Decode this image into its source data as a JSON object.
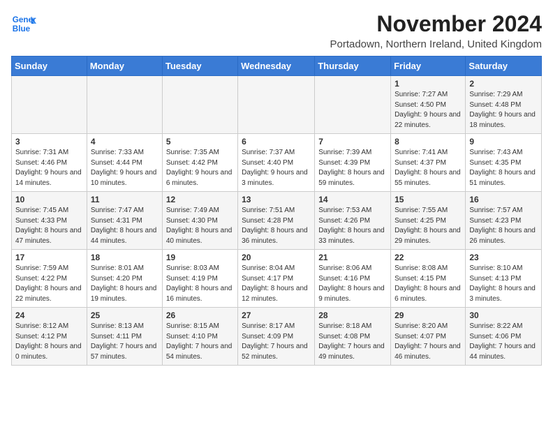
{
  "header": {
    "logo_line1": "General",
    "logo_line2": "Blue",
    "title": "November 2024",
    "subtitle": "Portadown, Northern Ireland, United Kingdom"
  },
  "days_of_week": [
    "Sunday",
    "Monday",
    "Tuesday",
    "Wednesday",
    "Thursday",
    "Friday",
    "Saturday"
  ],
  "weeks": [
    [
      {
        "day": "",
        "info": ""
      },
      {
        "day": "",
        "info": ""
      },
      {
        "day": "",
        "info": ""
      },
      {
        "day": "",
        "info": ""
      },
      {
        "day": "",
        "info": ""
      },
      {
        "day": "1",
        "info": "Sunrise: 7:27 AM\nSunset: 4:50 PM\nDaylight: 9 hours and 22 minutes."
      },
      {
        "day": "2",
        "info": "Sunrise: 7:29 AM\nSunset: 4:48 PM\nDaylight: 9 hours and 18 minutes."
      }
    ],
    [
      {
        "day": "3",
        "info": "Sunrise: 7:31 AM\nSunset: 4:46 PM\nDaylight: 9 hours and 14 minutes."
      },
      {
        "day": "4",
        "info": "Sunrise: 7:33 AM\nSunset: 4:44 PM\nDaylight: 9 hours and 10 minutes."
      },
      {
        "day": "5",
        "info": "Sunrise: 7:35 AM\nSunset: 4:42 PM\nDaylight: 9 hours and 6 minutes."
      },
      {
        "day": "6",
        "info": "Sunrise: 7:37 AM\nSunset: 4:40 PM\nDaylight: 9 hours and 3 minutes."
      },
      {
        "day": "7",
        "info": "Sunrise: 7:39 AM\nSunset: 4:39 PM\nDaylight: 8 hours and 59 minutes."
      },
      {
        "day": "8",
        "info": "Sunrise: 7:41 AM\nSunset: 4:37 PM\nDaylight: 8 hours and 55 minutes."
      },
      {
        "day": "9",
        "info": "Sunrise: 7:43 AM\nSunset: 4:35 PM\nDaylight: 8 hours and 51 minutes."
      }
    ],
    [
      {
        "day": "10",
        "info": "Sunrise: 7:45 AM\nSunset: 4:33 PM\nDaylight: 8 hours and 47 minutes."
      },
      {
        "day": "11",
        "info": "Sunrise: 7:47 AM\nSunset: 4:31 PM\nDaylight: 8 hours and 44 minutes."
      },
      {
        "day": "12",
        "info": "Sunrise: 7:49 AM\nSunset: 4:30 PM\nDaylight: 8 hours and 40 minutes."
      },
      {
        "day": "13",
        "info": "Sunrise: 7:51 AM\nSunset: 4:28 PM\nDaylight: 8 hours and 36 minutes."
      },
      {
        "day": "14",
        "info": "Sunrise: 7:53 AM\nSunset: 4:26 PM\nDaylight: 8 hours and 33 minutes."
      },
      {
        "day": "15",
        "info": "Sunrise: 7:55 AM\nSunset: 4:25 PM\nDaylight: 8 hours and 29 minutes."
      },
      {
        "day": "16",
        "info": "Sunrise: 7:57 AM\nSunset: 4:23 PM\nDaylight: 8 hours and 26 minutes."
      }
    ],
    [
      {
        "day": "17",
        "info": "Sunrise: 7:59 AM\nSunset: 4:22 PM\nDaylight: 8 hours and 22 minutes."
      },
      {
        "day": "18",
        "info": "Sunrise: 8:01 AM\nSunset: 4:20 PM\nDaylight: 8 hours and 19 minutes."
      },
      {
        "day": "19",
        "info": "Sunrise: 8:03 AM\nSunset: 4:19 PM\nDaylight: 8 hours and 16 minutes."
      },
      {
        "day": "20",
        "info": "Sunrise: 8:04 AM\nSunset: 4:17 PM\nDaylight: 8 hours and 12 minutes."
      },
      {
        "day": "21",
        "info": "Sunrise: 8:06 AM\nSunset: 4:16 PM\nDaylight: 8 hours and 9 minutes."
      },
      {
        "day": "22",
        "info": "Sunrise: 8:08 AM\nSunset: 4:15 PM\nDaylight: 8 hours and 6 minutes."
      },
      {
        "day": "23",
        "info": "Sunrise: 8:10 AM\nSunset: 4:13 PM\nDaylight: 8 hours and 3 minutes."
      }
    ],
    [
      {
        "day": "24",
        "info": "Sunrise: 8:12 AM\nSunset: 4:12 PM\nDaylight: 8 hours and 0 minutes."
      },
      {
        "day": "25",
        "info": "Sunrise: 8:13 AM\nSunset: 4:11 PM\nDaylight: 7 hours and 57 minutes."
      },
      {
        "day": "26",
        "info": "Sunrise: 8:15 AM\nSunset: 4:10 PM\nDaylight: 7 hours and 54 minutes."
      },
      {
        "day": "27",
        "info": "Sunrise: 8:17 AM\nSunset: 4:09 PM\nDaylight: 7 hours and 52 minutes."
      },
      {
        "day": "28",
        "info": "Sunrise: 8:18 AM\nSunset: 4:08 PM\nDaylight: 7 hours and 49 minutes."
      },
      {
        "day": "29",
        "info": "Sunrise: 8:20 AM\nSunset: 4:07 PM\nDaylight: 7 hours and 46 minutes."
      },
      {
        "day": "30",
        "info": "Sunrise: 8:22 AM\nSunset: 4:06 PM\nDaylight: 7 hours and 44 minutes."
      }
    ]
  ]
}
